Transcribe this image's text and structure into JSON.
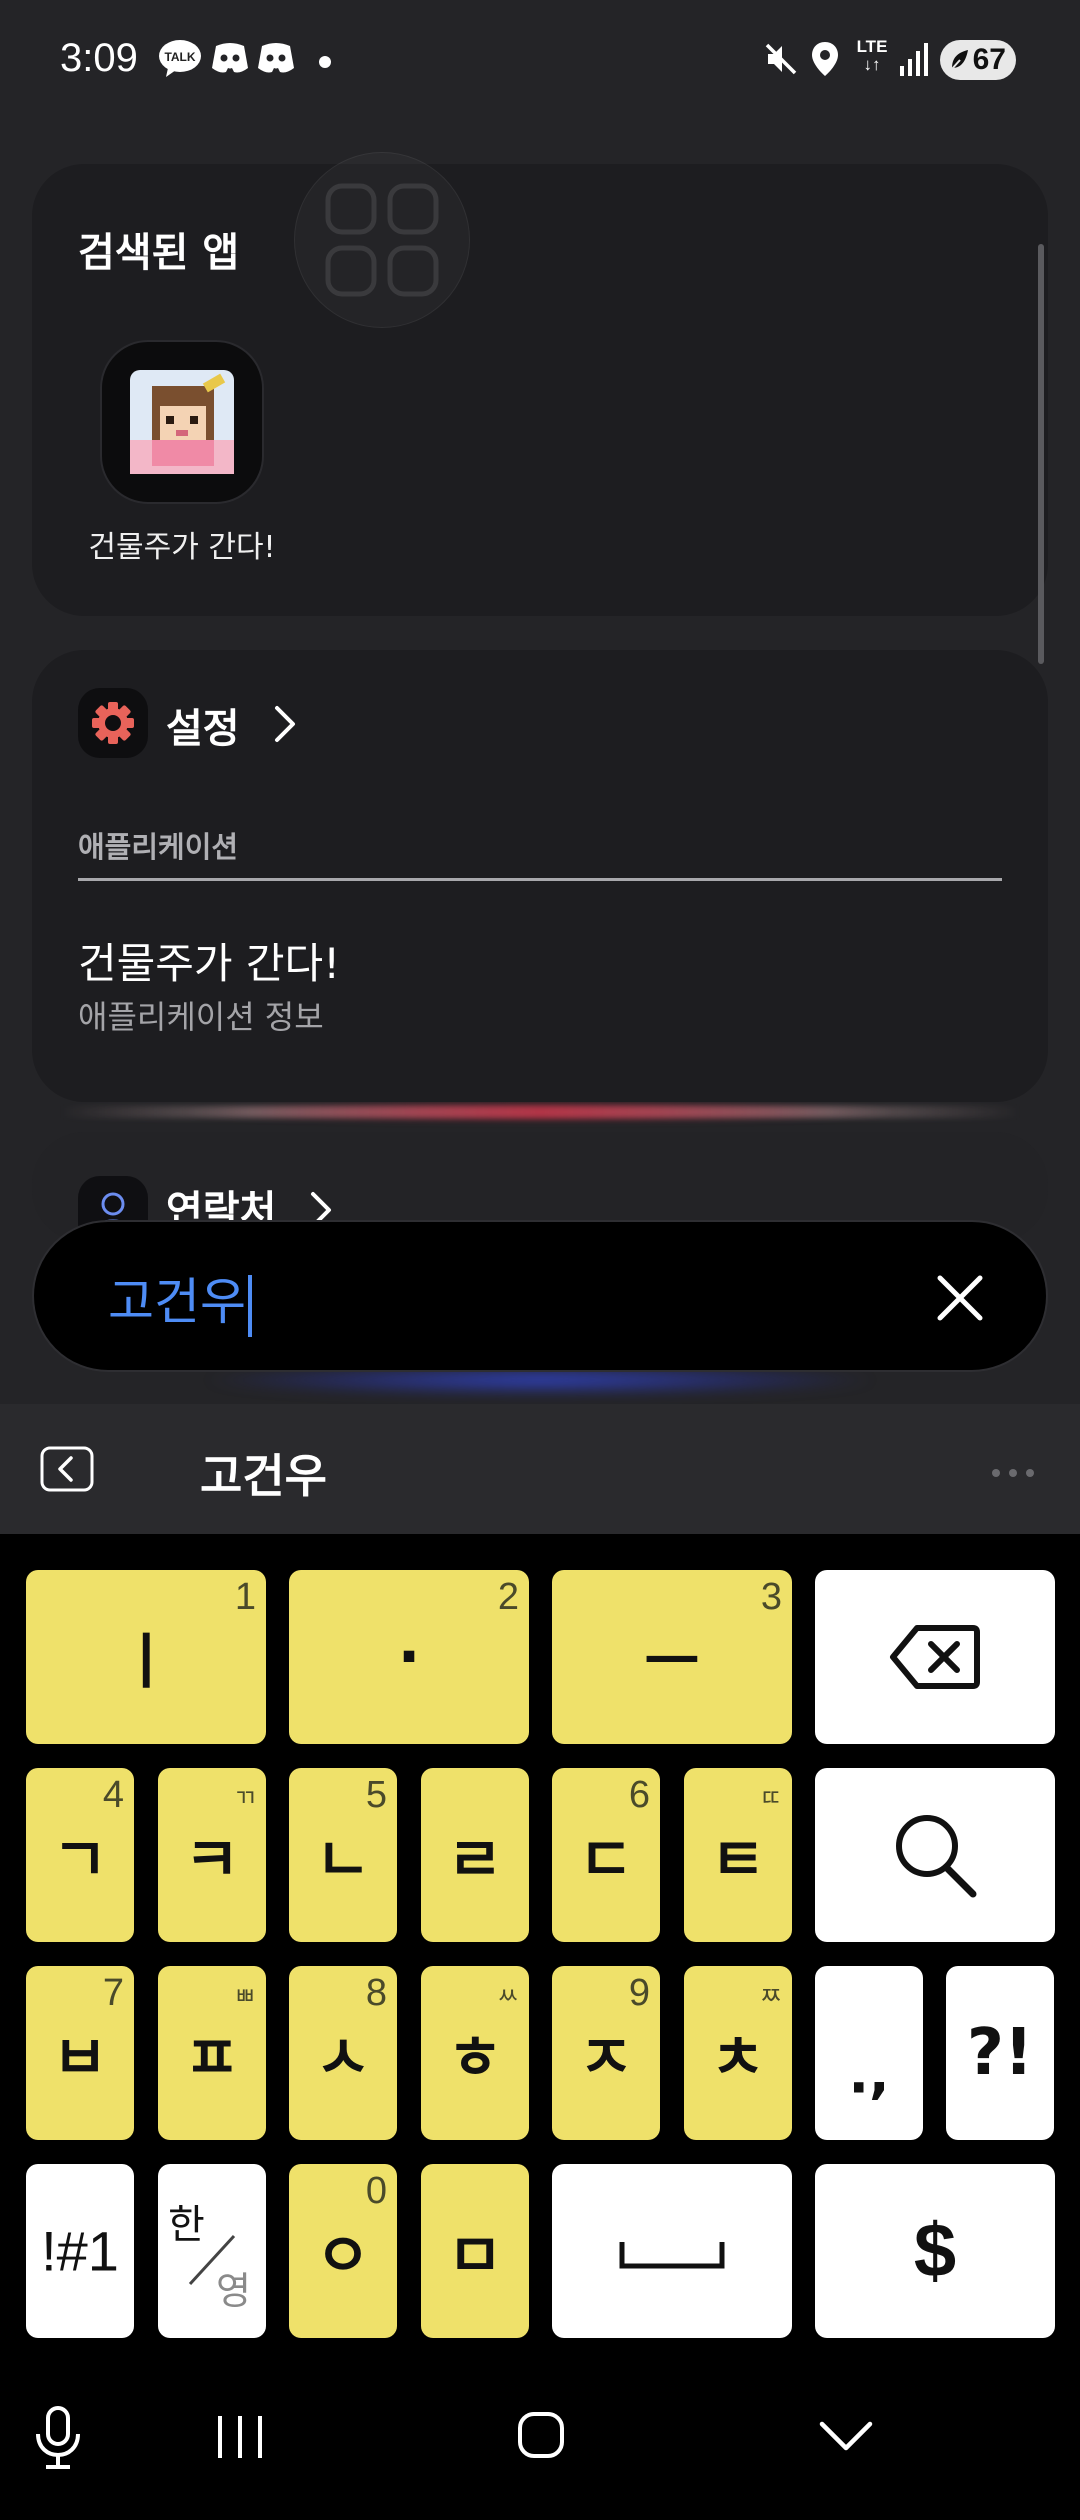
{
  "status_bar": {
    "time": "3:09",
    "talk_icon_text": "TALK",
    "network": "LTE",
    "battery": "67"
  },
  "apps_card": {
    "title": "검색된 앱",
    "app_label": "건물주가 간다!"
  },
  "settings_card": {
    "title": "설정",
    "section_label": "애플리케이션",
    "result_title": "건물주가 간다!",
    "result_subtitle": "애플리케이션 정보"
  },
  "contacts_card": {
    "title": "연락처"
  },
  "search": {
    "query": "고건우"
  },
  "suggestion_bar": {
    "word": "고건우"
  },
  "keyboard": {
    "row1": [
      {
        "main": "ㅣ",
        "sub": "1"
      },
      {
        "main": "·",
        "sub": "2"
      },
      {
        "main": "ㅡ",
        "sub": "3"
      }
    ],
    "row2": [
      {
        "main": "ㄱ",
        "sub": "4"
      },
      {
        "main": "ㅋ",
        "sub": "ㄲ"
      },
      {
        "main": "ㄴ",
        "sub": "5"
      },
      {
        "main": "ㄹ",
        "sub": ""
      },
      {
        "main": "ㄷ",
        "sub": "6"
      },
      {
        "main": "ㅌ",
        "sub": "ㄸ"
      }
    ],
    "row3": [
      {
        "main": "ㅂ",
        "sub": "7"
      },
      {
        "main": "ㅍ",
        "sub": "ㅃ"
      },
      {
        "main": "ㅅ",
        "sub": "8"
      },
      {
        "main": "ㅎ",
        "sub": "ㅆ"
      },
      {
        "main": "ㅈ",
        "sub": "9"
      },
      {
        "main": "ㅊ",
        "sub": "ㅉ"
      }
    ],
    "punct1": ".,",
    "punct2": "?!",
    "symbols": "!#1",
    "lang_top": "한",
    "lang_bottom": "영",
    "row4": [
      {
        "main": "ㅇ",
        "sub": "0"
      },
      {
        "main": "ㅁ",
        "sub": ""
      }
    ],
    "currency": "$"
  },
  "colors": {
    "key_yellow": "#efe16a",
    "search_text": "#4e8cf5"
  }
}
